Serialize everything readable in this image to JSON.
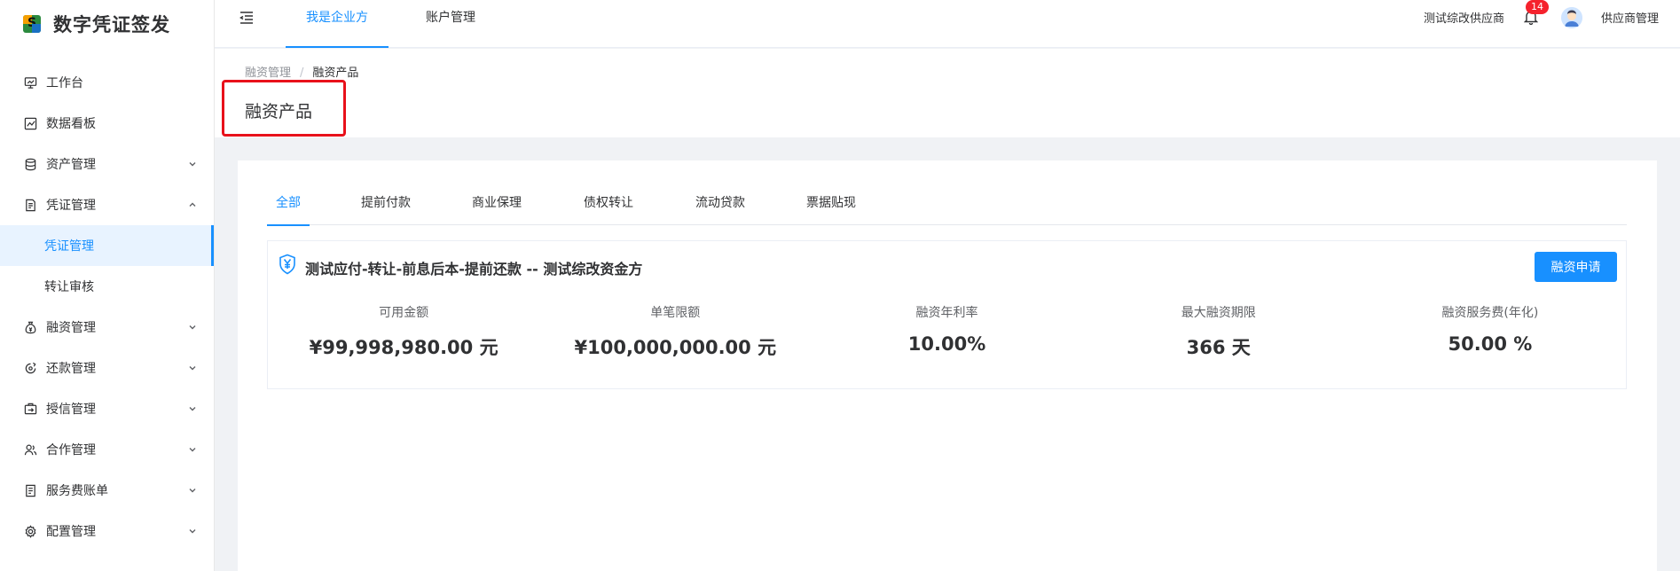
{
  "app": {
    "title": "数字凭证签发"
  },
  "sidebar": {
    "items": [
      {
        "label": "工作台",
        "icon": "monitor-icon"
      },
      {
        "label": "数据看板",
        "icon": "chart-icon"
      },
      {
        "label": "资产管理",
        "icon": "database-icon"
      },
      {
        "label": "凭证管理",
        "icon": "document-icon"
      },
      {
        "label": "凭证管理"
      },
      {
        "label": "转让审核"
      },
      {
        "label": "融资管理",
        "icon": "money-bag-icon"
      },
      {
        "label": "还款管理",
        "icon": "refund-icon"
      },
      {
        "label": "授信管理",
        "icon": "credit-icon"
      },
      {
        "label": "合作管理",
        "icon": "users-icon"
      },
      {
        "label": "服务费账单",
        "icon": "bill-icon"
      },
      {
        "label": "配置管理",
        "icon": "settings-icon"
      }
    ]
  },
  "header": {
    "tabs": [
      {
        "label": "我是企业方"
      },
      {
        "label": "账户管理"
      }
    ],
    "org_name": "测试综改供应商",
    "notification_count": "14",
    "user_name": "供应商管理"
  },
  "page": {
    "breadcrumb": [
      "融资管理",
      "/",
      "融资产品"
    ],
    "title": "融资产品"
  },
  "product_tabs": [
    "全部",
    "提前付款",
    "商业保理",
    "债权转让",
    "流动贷款",
    "票据贴现"
  ],
  "product": {
    "title": "测试应付-转让-前息后本-提前还款 -- 测试综改资金方",
    "apply_label": "融资申请",
    "stats": [
      {
        "label": "可用金额",
        "value": "¥99,998,980.00 元"
      },
      {
        "label": "单笔限额",
        "value": "¥100,000,000.00 元"
      },
      {
        "label": "融资年利率",
        "value": "10.00%"
      },
      {
        "label": "最大融资期限",
        "value": "366 天"
      },
      {
        "label": "融资服务费(年化)",
        "value": "50.00 %"
      }
    ]
  },
  "colors": {
    "primary": "#1890ff",
    "highlight": "#e8111b",
    "badge": "#f5222d"
  }
}
